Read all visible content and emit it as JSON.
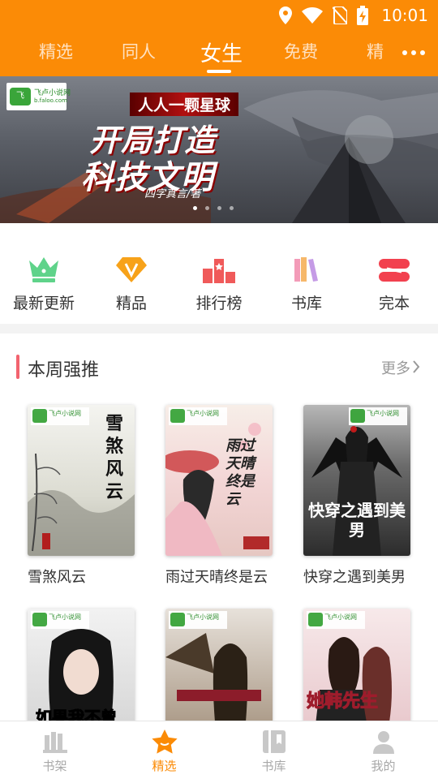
{
  "status_bar": {
    "time": "10:01",
    "icons": [
      "location-icon",
      "wifi-icon",
      "no-sim-icon",
      "battery-charging-icon"
    ]
  },
  "top_tabs": [
    {
      "label": "精选",
      "active": false
    },
    {
      "label": "同人",
      "active": false
    },
    {
      "label": "女生",
      "active": true
    },
    {
      "label": "免费",
      "active": false
    },
    {
      "label": "精",
      "active": false
    }
  ],
  "banner": {
    "site_name": "飞卢小说网",
    "site_domain": "b.faloo.com",
    "subtitle": "人人一颗星球",
    "title_line1": "开局打造",
    "title_line2": "科技文明",
    "author": "四字真言/著",
    "page_count": 4,
    "current_page": 1
  },
  "categories": [
    {
      "label": "最新更新",
      "icon": "crown-icon",
      "color": "#5fd38a"
    },
    {
      "label": "精品",
      "icon": "diamond-v-icon",
      "color": "#f7a21a"
    },
    {
      "label": "排行榜",
      "icon": "podium-icon",
      "color": "#f05a5a"
    },
    {
      "label": "书库",
      "icon": "books-icon",
      "color": "#f39bb8"
    },
    {
      "label": "完本",
      "icon": "finished-icon",
      "color": "#f2414f"
    }
  ],
  "section": {
    "title": "本周强推",
    "more": "更多"
  },
  "books": [
    {
      "name": "雪煞风云",
      "cover_title": "雪煞风云"
    },
    {
      "name": "雨过天晴终是云",
      "cover_title": "雨过天晴终是云"
    },
    {
      "name": "快穿之遇到美男",
      "cover_title": "快穿之遇到美男"
    },
    {
      "name": "",
      "cover_title": "如果我不曾"
    },
    {
      "name": "",
      "cover_title": ""
    },
    {
      "name": "",
      "cover_title": "她韩先生"
    }
  ],
  "bottom_nav": [
    {
      "label": "书架",
      "icon": "bookshelf-icon",
      "active": false
    },
    {
      "label": "精选",
      "icon": "star-icon",
      "active": true
    },
    {
      "label": "书库",
      "icon": "library-icon",
      "active": false
    },
    {
      "label": "我的",
      "icon": "profile-icon",
      "active": false
    }
  ],
  "colors": {
    "brand": "#fb8b06",
    "accent_bar": "#f2636f",
    "inactive": "#a8a8a8"
  }
}
